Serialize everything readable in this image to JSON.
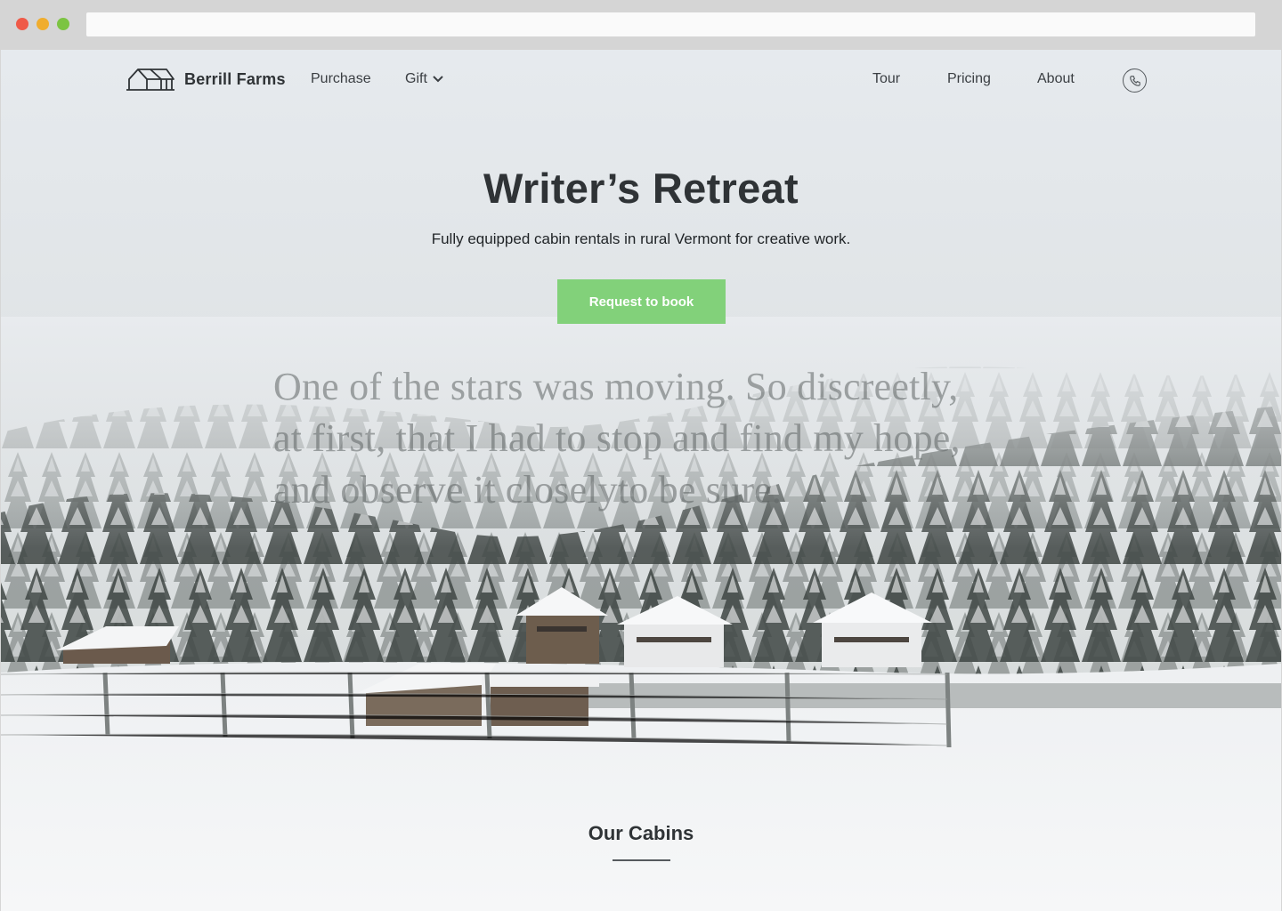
{
  "nav": {
    "brand": "Berrill Farms",
    "links": {
      "purchase": "Purchase",
      "gift": "Gift",
      "tour": "Tour",
      "pricing": "Pricing",
      "about": "About"
    }
  },
  "hero": {
    "title": "Writer’s Retreat",
    "subtitle": "Fully equipped cabin rentals in rural Vermont for creative work.",
    "cta_label": "Request to book"
  },
  "quote": {
    "line1": "One of the stars was moving. So discreetly,",
    "line2": "at first, that I had to stop and find my hope,",
    "line3": "and observe it closelyto be sure."
  },
  "sections": {
    "cabins_title": "Our Cabins"
  },
  "colors": {
    "cta_green": "#82d17a",
    "text_dark": "#2f3336"
  },
  "icons": {
    "logo": "house-outline-icon",
    "gift_dropdown": "chevron-down-icon",
    "phone": "phone-icon"
  }
}
